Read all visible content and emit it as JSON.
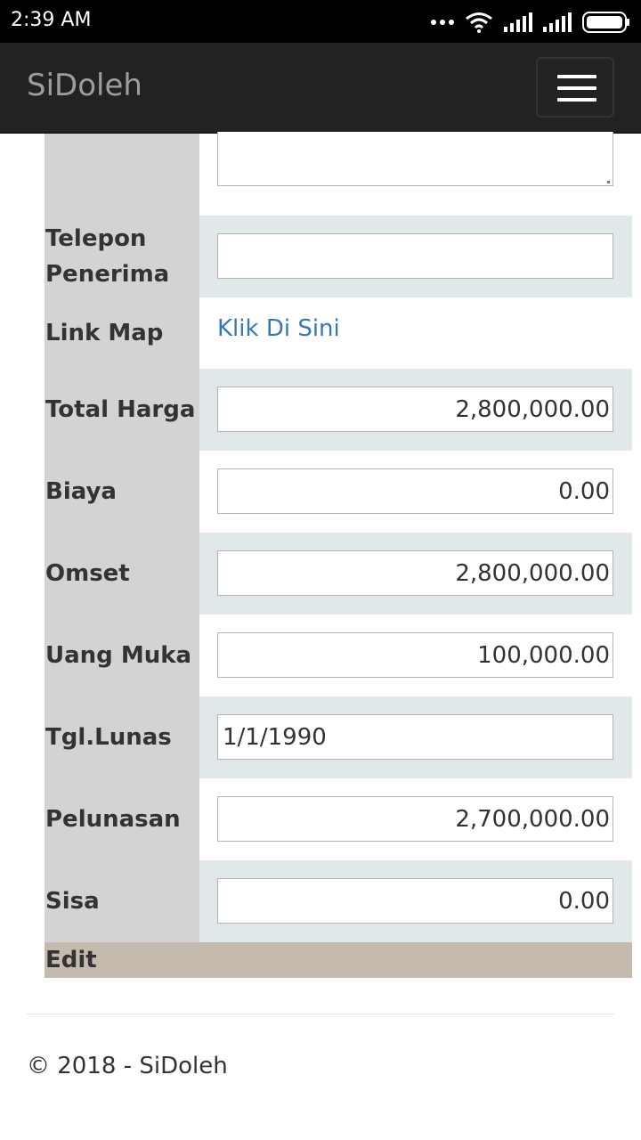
{
  "status_bar": {
    "time": "2:39 AM",
    "icons": [
      "more-dots-icon",
      "wifi-icon",
      "signal-icon",
      "signal-icon",
      "battery-icon"
    ]
  },
  "navbar": {
    "brand": "SiDoleh",
    "menu_icon": "hamburger-menu-icon"
  },
  "form": {
    "telepon_label": "Telepon Penerima",
    "telepon_value": "",
    "linkmap_label": "Link Map",
    "linkmap_text": "Klik Di Sini",
    "total_label": "Total Harga",
    "total_value": "2,800,000.00",
    "biaya_label": "Biaya",
    "biaya_value": "0.00",
    "omset_label": "Omset",
    "omset_value": "2,800,000.00",
    "uangmuka_label": "Uang Muka",
    "uangmuka_value": "100,000.00",
    "tgllunas_label": "Tgl.Lunas",
    "tgllunas_value": "1/1/1990",
    "pelunasan_label": "Pelunasan",
    "pelunasan_value": "2,700,000.00",
    "sisa_label": "Sisa",
    "sisa_value": "0.00",
    "edit_label": "Edit"
  },
  "footer": {
    "text": "© 2018 - SiDoleh"
  },
  "colors": {
    "navbar_bg": "#222222",
    "label_bg": "#d3d3d3",
    "alt_row_bg": "#e1e8ea",
    "edit_bar_bg": "#c4bbae",
    "link": "#337ab7"
  }
}
